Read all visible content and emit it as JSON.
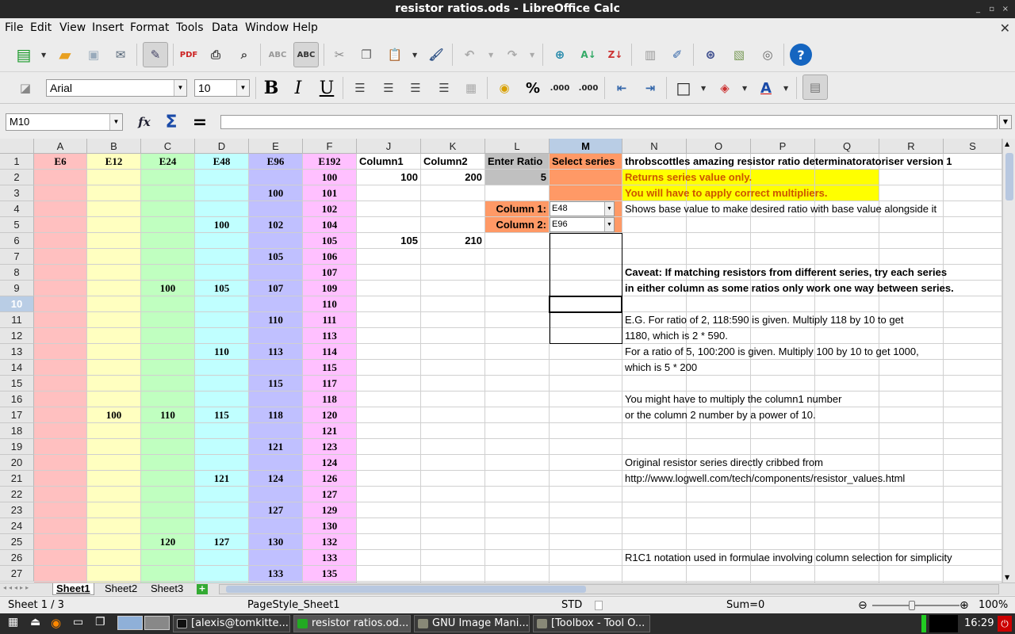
{
  "window": {
    "title": "resistor ratios.ods - LibreOffice Calc",
    "controls": [
      "_",
      "▫",
      "×"
    ]
  },
  "menu": [
    "File",
    "Edit",
    "View",
    "Insert",
    "Format",
    "Tools",
    "Data",
    "Window",
    "Help"
  ],
  "toolbar": {
    "font_name": "Arial",
    "font_size": "10",
    "bold": "B",
    "italic": "I",
    "underline": "U",
    "percent": "%",
    "add_decimal": ".000",
    "del_decimal": ".000",
    "help": "?"
  },
  "formula_bar": {
    "name_box": "M10",
    "function_wizard": "fx",
    "sum": "Σ",
    "equals": "=",
    "input": ""
  },
  "columns": [
    "A",
    "B",
    "C",
    "D",
    "E",
    "F",
    "J",
    "K",
    "L",
    "M",
    "N",
    "O",
    "P",
    "Q",
    "R",
    "S"
  ],
  "rows": [
    "1",
    "2",
    "3",
    "4",
    "5",
    "6",
    "7",
    "8",
    "9",
    "10",
    "11",
    "12",
    "13",
    "14",
    "15",
    "16",
    "17",
    "18",
    "19",
    "20",
    "21",
    "22",
    "23",
    "24",
    "25",
    "26",
    "27"
  ],
  "selected_cell": {
    "column": "M",
    "row": "10"
  },
  "series_headers": {
    "A": "E6",
    "B": "E12",
    "C": "E24",
    "D": "E48",
    "E": "E96",
    "F": "E192"
  },
  "series_values": {
    "B": [
      {
        "row": 17,
        "v": "100"
      }
    ],
    "C": [
      {
        "row": 9,
        "v": "100"
      },
      {
        "row": 17,
        "v": "110"
      },
      {
        "row": 25,
        "v": "120"
      }
    ],
    "D": [
      {
        "row": 5,
        "v": "100"
      },
      {
        "row": 9,
        "v": "105"
      },
      {
        "row": 13,
        "v": "110"
      },
      {
        "row": 17,
        "v": "115"
      },
      {
        "row": 21,
        "v": "121"
      },
      {
        "row": 25,
        "v": "127"
      }
    ],
    "E": [
      {
        "row": 3,
        "v": "100"
      },
      {
        "row": 5,
        "v": "102"
      },
      {
        "row": 7,
        "v": "105"
      },
      {
        "row": 9,
        "v": "107"
      },
      {
        "row": 11,
        "v": "110"
      },
      {
        "row": 13,
        "v": "113"
      },
      {
        "row": 15,
        "v": "115"
      },
      {
        "row": 17,
        "v": "118"
      },
      {
        "row": 19,
        "v": "121"
      },
      {
        "row": 21,
        "v": "124"
      },
      {
        "row": 23,
        "v": "127"
      },
      {
        "row": 25,
        "v": "130"
      },
      {
        "row": 27,
        "v": "133"
      }
    ],
    "F": [
      {
        "row": 2,
        "v": "100"
      },
      {
        "row": 3,
        "v": "101"
      },
      {
        "row": 4,
        "v": "102"
      },
      {
        "row": 5,
        "v": "104"
      },
      {
        "row": 6,
        "v": "105"
      },
      {
        "row": 7,
        "v": "106"
      },
      {
        "row": 8,
        "v": "107"
      },
      {
        "row": 9,
        "v": "109"
      },
      {
        "row": 10,
        "v": "110"
      },
      {
        "row": 11,
        "v": "111"
      },
      {
        "row": 12,
        "v": "113"
      },
      {
        "row": 13,
        "v": "114"
      },
      {
        "row": 14,
        "v": "115"
      },
      {
        "row": 15,
        "v": "117"
      },
      {
        "row": 16,
        "v": "118"
      },
      {
        "row": 17,
        "v": "120"
      },
      {
        "row": 18,
        "v": "121"
      },
      {
        "row": 19,
        "v": "123"
      },
      {
        "row": 20,
        "v": "124"
      },
      {
        "row": 21,
        "v": "126"
      },
      {
        "row": 22,
        "v": "127"
      },
      {
        "row": 23,
        "v": "129"
      },
      {
        "row": 24,
        "v": "130"
      },
      {
        "row": 25,
        "v": "132"
      },
      {
        "row": 26,
        "v": "133"
      },
      {
        "row": 27,
        "v": "135"
      }
    ]
  },
  "cells": {
    "J1": "Column1",
    "K1": "Column2",
    "L1": "Enter Ratio",
    "M1": "Select series",
    "J2": "100",
    "K2": "200",
    "L2": "5",
    "J6": "105",
    "K6": "210",
    "L4": "Column 1:",
    "L5": "Column 2:",
    "M4": "E48",
    "M5": "E96",
    "N1": "throbscottles amazing resistor ratio determinatoratoriser version 1",
    "N2": "Returns series value only.",
    "N3": "You will have to apply correct multipliers.",
    "N4": "Shows base value to make desired ratio with base value alongside it",
    "N8": "Caveat: If matching resistors from different series, try each series",
    "N9": "in either column as some ratios only work one way between series.",
    "N11": "E.G. For ratio of 2, 118:590 is given. Multiply 118 by 10 to get",
    "N12": "1180, which is 2 * 590.",
    "N13": "For a ratio of 5, 100:200 is given. Multiply 100 by 10 to get 1000,",
    "N14": "which is 5 * 200",
    "N16": "You might have to multiply the column1 number",
    "N17": "or the column 2 number by a power of 10.",
    "N20": "Original resistor series directly cribbed from",
    "N21": "http://www.logwell.com/tech/components/resistor_values.html",
    "N26": "R1C1 notation used in formulae involving column selection for simplicity"
  },
  "colors": {
    "E6": "#ffc0c0",
    "E12": "#ffffc0",
    "E24": "#c0ffc0",
    "E48": "#c0ffff",
    "E96": "#c0c0ff",
    "E192": "#ffc0ff",
    "orange": "#ff9966",
    "yellow": "#ffff00",
    "ratio_gray": "#c0c0c0",
    "selection": "#b9cde5"
  },
  "sheet_tabs": [
    "Sheet1",
    "Sheet2",
    "Sheet3"
  ],
  "statusbar": {
    "sheet": "Sheet 1 / 3",
    "page_style": "PageStyle_Sheet1",
    "mode": "STD",
    "sum": "Sum=0",
    "zoom": "100%"
  },
  "taskbar": {
    "tasks": [
      "[alexis@tomkitte...",
      "resistor ratios.od...",
      "GNU Image Mani...",
      "[Toolbox - Tool O..."
    ],
    "clock": "16:29"
  }
}
